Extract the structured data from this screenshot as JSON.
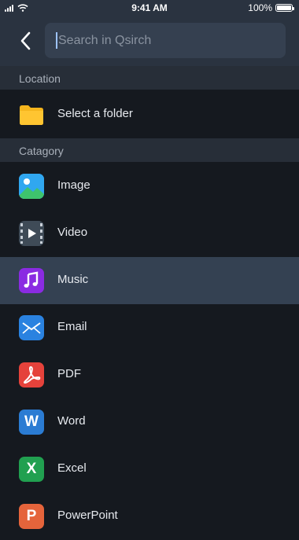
{
  "status_bar": {
    "time": "9:41 AM",
    "battery": "100%"
  },
  "search": {
    "placeholder": "Search in Qsirch"
  },
  "location": {
    "header": "Location",
    "folder_label": "Select a folder"
  },
  "category": {
    "header": "Catagory",
    "items": [
      {
        "label": "Image",
        "icon": "image-icon",
        "color": "#2b9be6"
      },
      {
        "label": "Video",
        "icon": "video-icon",
        "color": "#3f4b57"
      },
      {
        "label": "Music",
        "icon": "music-icon",
        "color": "#8a2be2",
        "selected": true
      },
      {
        "label": "Email",
        "icon": "email-icon",
        "color": "#2a82e0"
      },
      {
        "label": "PDF",
        "icon": "pdf-icon",
        "color": "#e5423b"
      },
      {
        "label": "Word",
        "icon": "word-icon",
        "color": "#2b7cd3"
      },
      {
        "label": "Excel",
        "icon": "excel-icon",
        "color": "#21a050"
      },
      {
        "label": "PowerPoint",
        "icon": "powerpoint-icon",
        "color": "#e5643b"
      }
    ]
  },
  "colors": {
    "folder": "#f5b51d",
    "selected_row": "#344152",
    "header_bg": "#2a3340"
  }
}
